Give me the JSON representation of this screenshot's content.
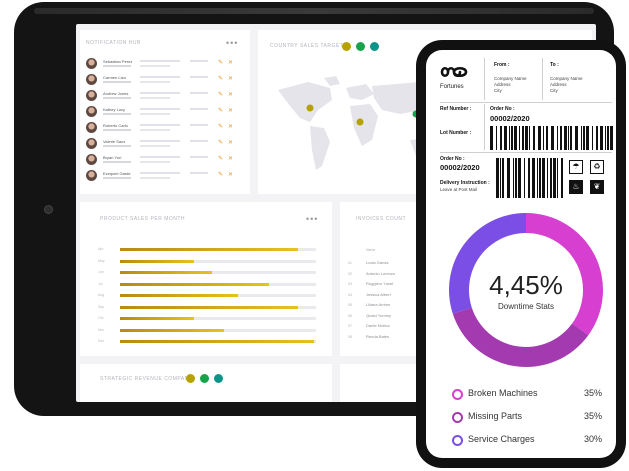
{
  "tablet": {
    "notifications": {
      "title": "NOTIFICATION HUB",
      "more": "•••",
      "items": [
        {
          "name": "Sebastian Perez"
        },
        {
          "name": "Carmen Liza"
        },
        {
          "name": "Andrew Jones"
        },
        {
          "name": "Kathey Lucy"
        },
        {
          "name": "Roberto Carlo"
        },
        {
          "name": "Valerie Sanz"
        },
        {
          "name": "Bryan Yuri"
        },
        {
          "name": "Ezequiel Garde"
        }
      ]
    },
    "country_sales": {
      "title": "COUNTRY SALES TARGET"
    },
    "product_sales": {
      "title": "PRODUCT SALES PER MONTH",
      "more": "•••",
      "bars": [
        0.91,
        0.38,
        0.47,
        0.76,
        0.6,
        0.91,
        0.38,
        0.53,
        0.99
      ],
      "labels": [
        "Apr",
        "May",
        "Jun",
        "Jul",
        "Aug",
        "Sep",
        "Oct",
        "Nov",
        "Dec"
      ]
    },
    "invoices": {
      "title": "INVOICES COUNT",
      "header": "Name",
      "items": [
        {
          "num": "01",
          "name": "Lucia Garcia"
        },
        {
          "num": "02",
          "name": "Antonio Lorenzo"
        },
        {
          "num": "03",
          "name": "Ruggiero Yusef"
        },
        {
          "num": "04",
          "name": "Jessica Albert"
        },
        {
          "num": "05",
          "name": "Liliana Arrime"
        },
        {
          "num": "06",
          "name": "Quaid Yummy"
        },
        {
          "num": "07",
          "name": "Dante Molina"
        },
        {
          "num": "08",
          "name": "Renda Bates"
        }
      ]
    },
    "strategic": {
      "title": "STRATEGIC REVENUE COMPANY"
    }
  },
  "phone": {
    "brand": "Fortunes",
    "from_label": "From :",
    "to_label": "To :",
    "from_lines": [
      "Company Name",
      "Address",
      "City"
    ],
    "to_lines": [
      "Company Name",
      "Address",
      "City"
    ],
    "ref_label": "Ref Number :",
    "lot_label": "Lot Number :",
    "order_label": "Order No :",
    "order_no": "00002/2020",
    "order_label2": "Order No :",
    "order_no2": "00002/2020",
    "delivery_label": "Delivery Instruction :",
    "delivery_value": "Leave at Post Mail",
    "donut": {
      "value": "4,45%",
      "caption": "Downtime Stats",
      "segments": [
        {
          "name": "Broken Machines",
          "pct": 35,
          "color": "#d63fd0"
        },
        {
          "name": "Missing Parts",
          "pct": 35,
          "color": "#a33ab0"
        },
        {
          "name": "Service Charges",
          "pct": 30,
          "color": "#7b4ee6"
        }
      ]
    },
    "legend": [
      {
        "name": "Broken Machines",
        "value": "35%"
      },
      {
        "name": "Missing Parts",
        "value": "35%"
      },
      {
        "name": "Service Charges",
        "value": "30%"
      }
    ]
  },
  "colors": {
    "olive": "#b5a200",
    "green": "#16a34a",
    "teal": "#0d9488",
    "gold": "#d8b316"
  }
}
